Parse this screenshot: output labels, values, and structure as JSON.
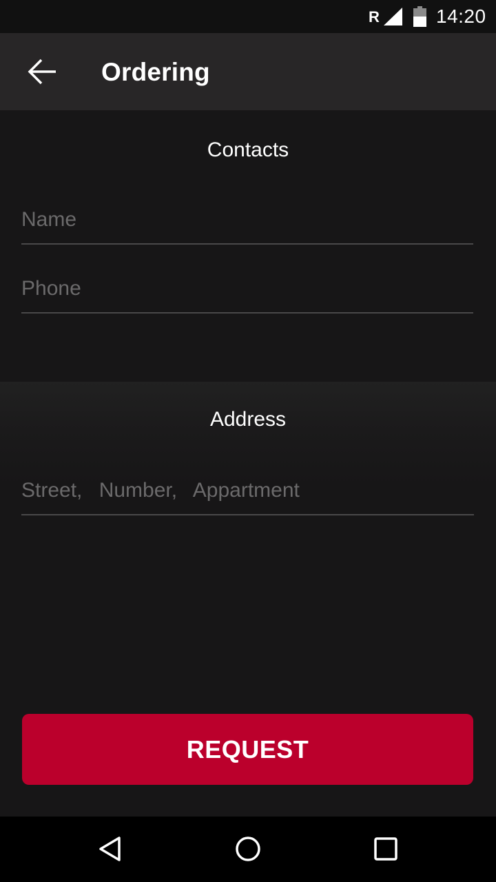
{
  "status_bar": {
    "network_letter": "R",
    "time": "14:20",
    "icons": [
      "signal-icon",
      "battery-icon"
    ]
  },
  "app_bar": {
    "back_icon": "arrow-left-icon",
    "title": "Ordering"
  },
  "contacts": {
    "title": "Contacts",
    "name_placeholder": "Name",
    "name_value": "",
    "phone_placeholder": "Phone",
    "phone_value": ""
  },
  "address": {
    "title": "Address",
    "address_placeholder": "Street, Number, Appartment",
    "address_value": ""
  },
  "request_button": {
    "label": "REQUEST",
    "color": "#bb002c"
  },
  "nav_bar": {
    "icons": [
      "nav-back-icon",
      "nav-home-icon",
      "nav-recents-icon"
    ]
  },
  "colors": {
    "background": "#171617",
    "app_bar": "#282627",
    "accent": "#bb002c",
    "placeholder": "#6b6a6b"
  }
}
